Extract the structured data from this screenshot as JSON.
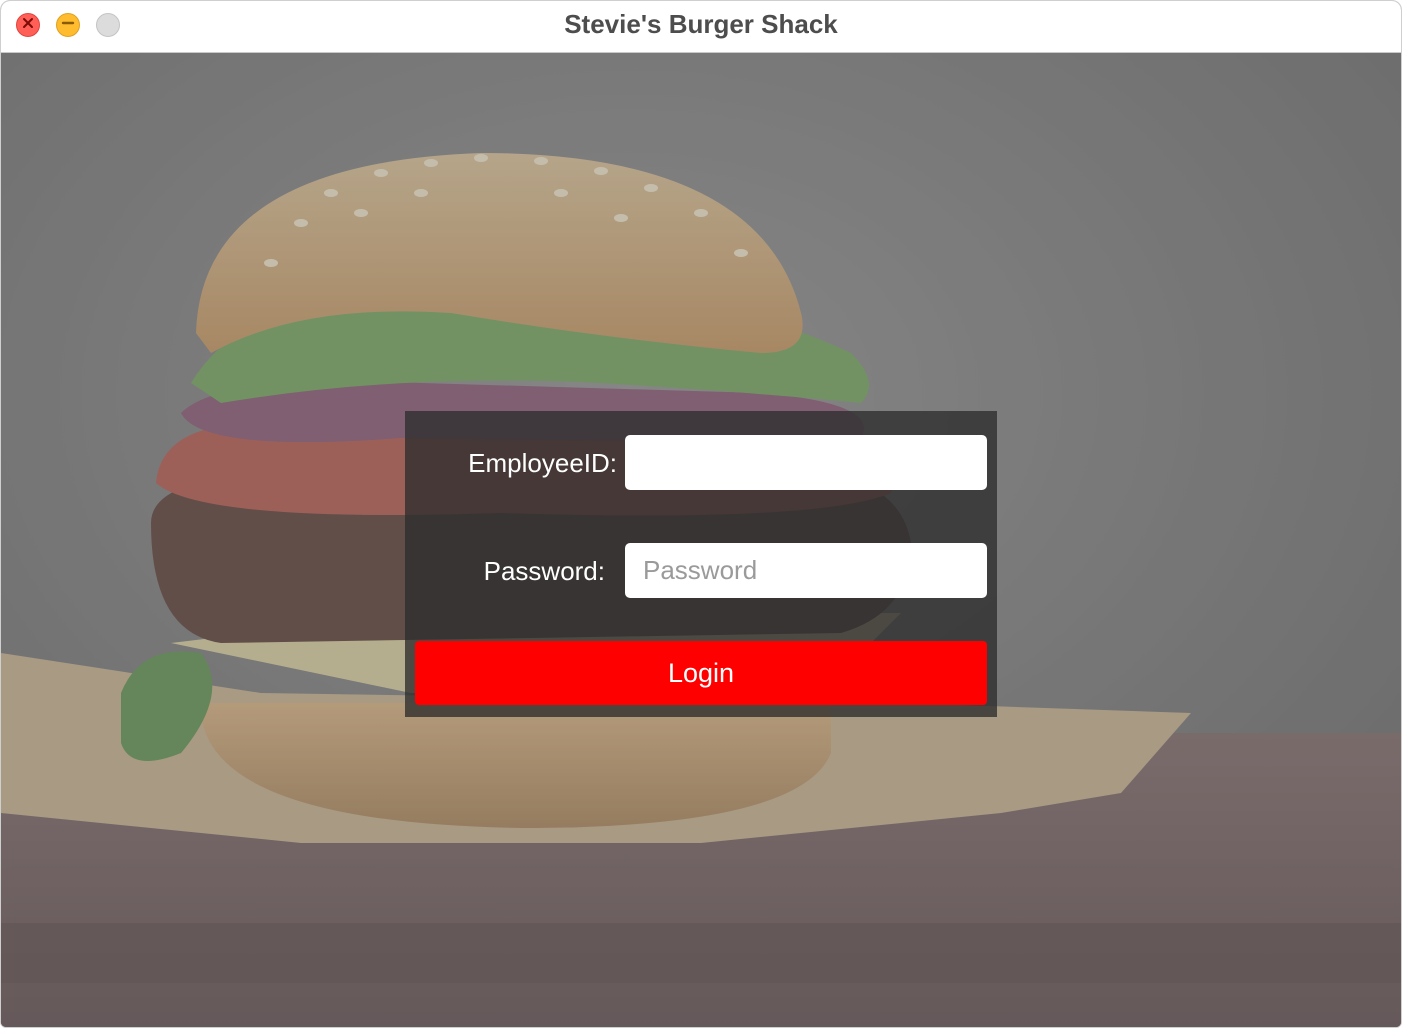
{
  "window": {
    "title": "Stevie's Burger Shack",
    "controls": [
      "close-icon",
      "minimize-icon",
      "zoom-icon"
    ]
  },
  "background": {
    "subject": "burger-photo"
  },
  "login": {
    "employee_label": "EmployeeID:",
    "employee_value": "",
    "employee_placeholder": "",
    "password_label": "Password:",
    "password_value": "",
    "password_placeholder": "Password",
    "button_label": "Login"
  },
  "colors": {
    "accent": "#ff0000",
    "panel": "#2d2d2d",
    "close": "#ff5f57",
    "minimize": "#febc2e",
    "zoom": "#dcdcdc"
  }
}
